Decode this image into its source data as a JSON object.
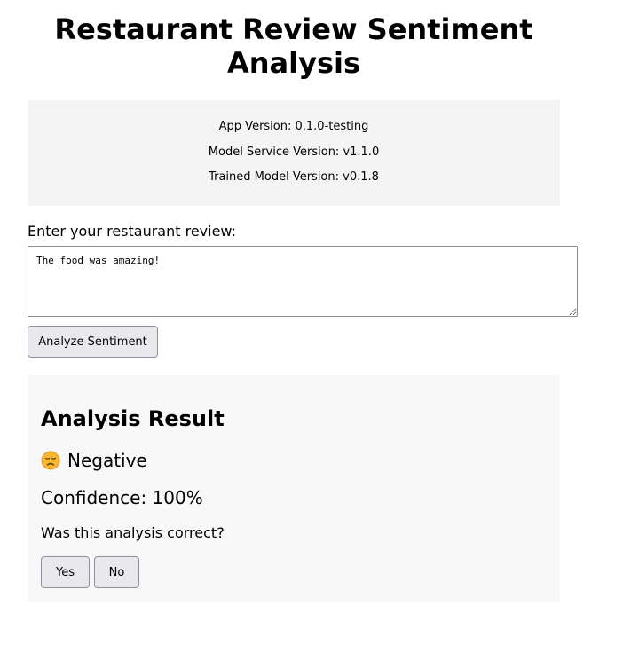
{
  "header": {
    "title": "Restaurant Review Sentiment Analysis"
  },
  "versions": {
    "app": "App Version: 0.1.0-testing",
    "model_service": "Model Service Version: v1.1.0",
    "trained_model": "Trained Model Version: v0.1.8"
  },
  "review": {
    "label": "Enter your restaurant review:",
    "value": "The food was amazing!",
    "submit_label": "Analyze Sentiment"
  },
  "result": {
    "title": "Analysis Result",
    "sentiment_icon": "disappointed-face-emoji",
    "sentiment": "Negative",
    "confidence": "Confidence: 100%",
    "feedback_question": "Was this analysis correct?",
    "yes_label": "Yes",
    "no_label": "No"
  },
  "colors": {
    "version_box_bg": "#f4f4f4",
    "result_box_bg": "#f8f8f8",
    "button_bg": "#e9e9ed",
    "emoji_face": "#f7b731"
  }
}
